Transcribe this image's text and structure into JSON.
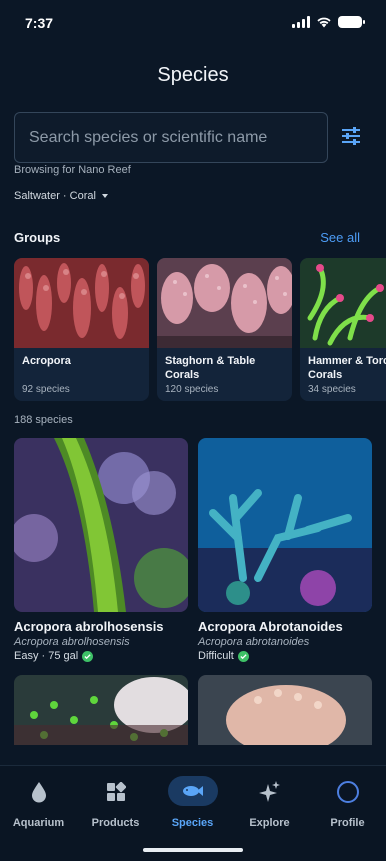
{
  "status_bar": {
    "time": "7:37"
  },
  "header": {
    "title": "Species"
  },
  "search": {
    "placeholder": "Search species or scientific name",
    "value": ""
  },
  "context": {
    "browsing": "Browsing for Nano Reef",
    "filter": "Saltwater · Coral"
  },
  "groups": {
    "title": "Groups",
    "see_all": "See all",
    "items": [
      {
        "name": "Acropora",
        "count": "92 species"
      },
      {
        "name": "Staghorn & Table Corals",
        "count": "120 species"
      },
      {
        "name": "Hammer & Torch Corals",
        "count": "34 species"
      }
    ]
  },
  "species": {
    "count": "188 species",
    "items": [
      {
        "name": "Acropora abrolhosensis",
        "scientific": "Acropora abrolhosensis",
        "meta": "Easy · 75 gal",
        "verified": true
      },
      {
        "name": "Acropora Abrotanoides",
        "scientific": "Acropora abrotanoides",
        "meta": "Difficult",
        "verified": true
      }
    ]
  },
  "nav": {
    "items": [
      {
        "label": "Aquarium",
        "icon": "drop-icon"
      },
      {
        "label": "Products",
        "icon": "products-icon"
      },
      {
        "label": "Species",
        "icon": "fish-icon",
        "active": true
      },
      {
        "label": "Explore",
        "icon": "sparkle-icon"
      },
      {
        "label": "Profile",
        "icon": "profile-icon"
      }
    ]
  },
  "colors": {
    "background": "#0b1726",
    "accent": "#4d9cf5",
    "verified": "#3ec167"
  }
}
